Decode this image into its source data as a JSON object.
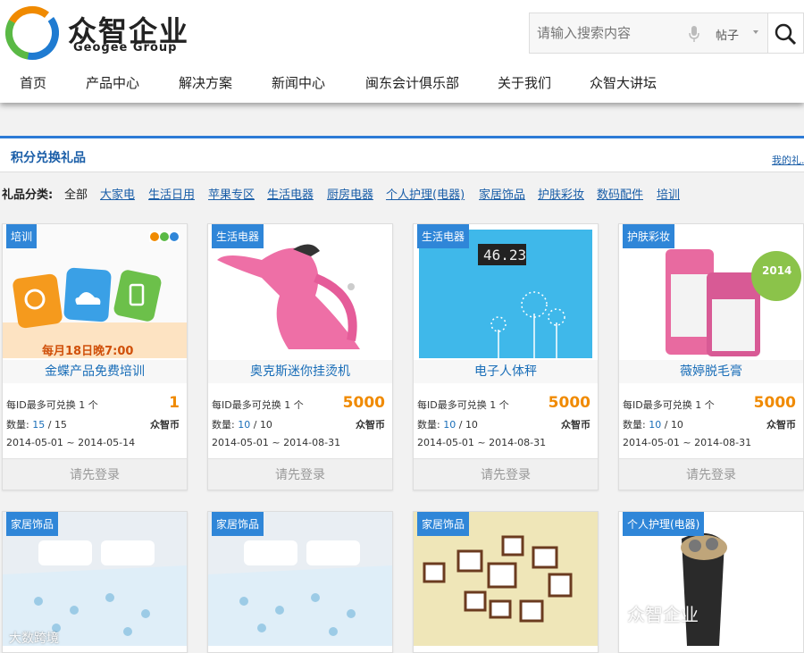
{
  "brand": {
    "name": "众智企业",
    "sub": "Geogee Group"
  },
  "search": {
    "placeholder": "请输入搜索内容",
    "type": "帖子"
  },
  "nav": [
    "首页",
    "产品中心",
    "解决方案",
    "新闻中心",
    "闽东会计俱乐部",
    "关于我们",
    "众智大讲坛"
  ],
  "section": {
    "title": "积分兑换礼品",
    "link": "我的礼..."
  },
  "categories": {
    "label": "礼品分类:",
    "items": [
      "全部",
      "大家电",
      "生活日用",
      "苹果专区",
      "生活电器",
      "厨房电器",
      "个人护理(电器)",
      "家居饰品",
      "护肤彩妆",
      "数码配件",
      "培训"
    ]
  },
  "cards": [
    {
      "tag": "培训",
      "title": "金蝶产品免费培训",
      "limit": "每ID最多可兑换 1 个",
      "points": "1",
      "unit": "众智币",
      "qty_label": "数量:",
      "qty_left": "15",
      "qty_sep": "/",
      "qty_total": "15",
      "date": "2014-05-01 ~ 2014-05-14",
      "button": "请先登录",
      "img_text": "每月18日晚7:00"
    },
    {
      "tag": "生活电器",
      "title": "奥克斯迷你挂烫机",
      "limit": "每ID最多可兑换 1 个",
      "points": "5000",
      "unit": "众智币",
      "qty_label": "数量:",
      "qty_left": "10",
      "qty_sep": "/",
      "qty_total": "10",
      "date": "2014-05-01 ~ 2014-08-31",
      "button": "请先登录"
    },
    {
      "tag": "生活电器",
      "title": "电子人体秤",
      "limit": "每ID最多可兑换 1 个",
      "points": "5000",
      "unit": "众智币",
      "qty_label": "数量:",
      "qty_left": "10",
      "qty_sep": "/",
      "qty_total": "10",
      "date": "2014-05-01 ~ 2014-08-31",
      "button": "请先登录",
      "img_text": "46.23"
    },
    {
      "tag": "护肤彩妆",
      "title": "薇婷脱毛膏",
      "limit": "每ID最多可兑换 1 个",
      "points": "5000",
      "unit": "众智币",
      "qty_label": "数量:",
      "qty_left": "10",
      "qty_sep": "/",
      "qty_total": "10",
      "date": "2014-05-01 ~ 2014-08-31",
      "button": "请先登录",
      "img_text": "2014"
    }
  ],
  "cards2": [
    {
      "tag": "家居饰品"
    },
    {
      "tag": "家居饰品"
    },
    {
      "tag": "家居饰品"
    },
    {
      "tag": "个人护理(电器)"
    }
  ],
  "watermark": "众智企业",
  "watermark2": "大数跨境",
  "colors": {
    "accent": "#2c7ad6",
    "points": "#f08a00",
    "tag": "#2f86d8"
  }
}
